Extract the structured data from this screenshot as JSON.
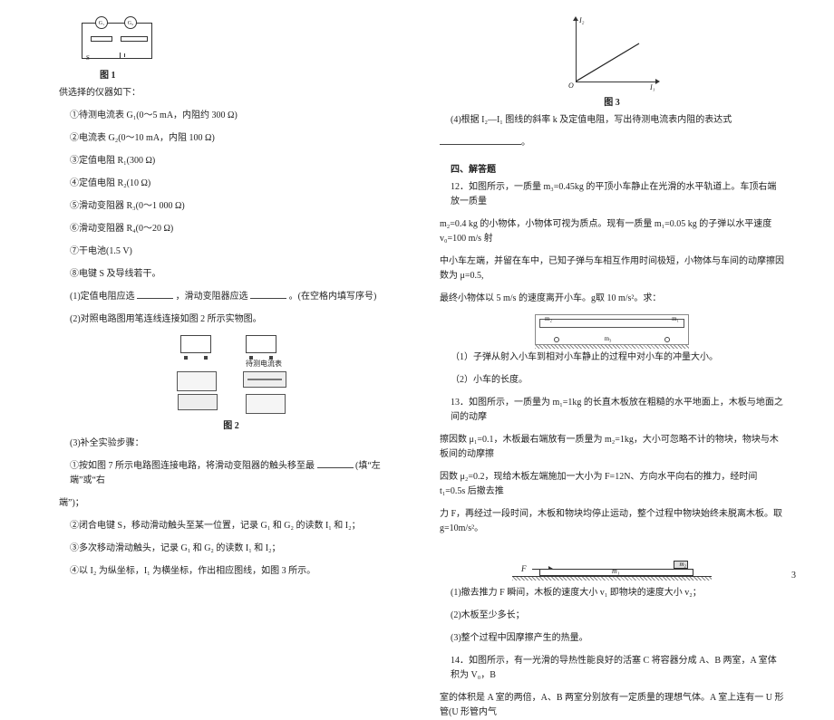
{
  "left": {
    "fig1_caption": "图 1",
    "instruments_intro": "供选择的仪器如下：",
    "items": [
      "①待测电流表 G₁(0～5 mA，内阻约 300 Ω)",
      "②电流表 G₂(0～10 mA，内阻 100 Ω)",
      "③定值电阻 R₁(300 Ω)",
      "④定值电阻 R₂(10 Ω)",
      "⑤滑动变阻器 R₃(0～1 000 Ω)",
      "⑥滑动变阻器 R₄(0～20 Ω)",
      "⑦干电池(1.5 V)",
      "⑧电键 S 及导线若干。"
    ],
    "q1_pre": "(1)定值电阻应选",
    "q1_mid": "，滑动变阻器应选",
    "q1_post": "。(在空格内填写序号)",
    "q2": "(2)对照电路图用笔连线连接如图 2 所示实物图。",
    "fig2_label_meter": "待测电流表",
    "fig2_caption": "图 2",
    "q3_head": "(3)补全实验步骤：",
    "q3_step1_pre": "①按如图 7 所示电路图连接电路，将滑动变阻器的触头移至最",
    "q3_step1_hint": "(填“左端”或“右",
    "q3_step1_post": "端”)；",
    "q3_step2": "②闭合电键 S，移动滑动触头至某一位置，记录 G₁ 和 G₂ 的读数 I₁ 和 I₂；",
    "q3_step3": "③多次移动滑动触头，记录 G₁ 和 G₂ 的读数 I₁ 和 I₂；",
    "q3_step4": "④以 I₂ 为纵坐标，I₁ 为横坐标，作出相应图线，如图 3 所示。"
  },
  "right": {
    "fig3_caption": "图 3",
    "fig3_lblO": "O",
    "fig3_lblY": "I₂",
    "fig3_lblX": "I₁",
    "q4": "(4)根据 I₂—I₁ 图线的斜率 k 及定值电阻，写出待测电流表内阻的表达式",
    "sec4": "四、解答题",
    "p12a": "12．如图所示，一质量 m₃=0.45kg 的平顶小车静止在光滑的水平轨道上。车顶右端放一质量",
    "p12b": "m₂=0.4 kg 的小物体，小物体可视为质点。现有一质量 m₁=0.05 kg 的子弹以水平速度 v₀=100 m/s 射",
    "p12c": "中小车左端，并留在车中，已知子弹与车相互作用时间极短，小物体与车间的动摩擦因数为 μ=0.5,",
    "p12d": "最终小物体以 5 m/s 的速度离开小车。g取 10 m/s²。求：",
    "p12_cart_m1": "m₁",
    "p12_cart_m2": "m₂",
    "p12_cart_m3": "m₃",
    "p12q1": "（1）子弹从射入小车到相对小车静止的过程中对小车的冲量大小。",
    "p12q2": "（2）小车的长度。",
    "p13a": "13．如图所示，一质量为 m₁=1kg 的长直木板放在粗糙的水平地面上，木板与地面之间的动摩",
    "p13b": "擦因数 μ₁=0.1，木板最右端放有一质量为 m₂=1kg，大小可忽略不计的物块，物块与木板间的动摩擦",
    "p13c": "因数 μ₂=0.2，现给木板左端施加一大小为 F=12N、方向水平向右的推力，经时间 t₁=0.5s 后撤去推",
    "p13d": "力 F，再经过一段时间，木板和物块均停止运动，整个过程中物块始终未脱离木板。取 g=10m/s²。",
    "p13_F": "F",
    "p13_m1": "m₁",
    "p13_m2": "m₂",
    "p13q1": "(1)撤去推力 F 瞬间，木板的速度大小 v₁ 即物块的速度大小 v₂；",
    "p13q2": "(2)木板至少多长；",
    "p13q3": "(3)整个过程中因摩擦产生的热量。",
    "p14a": "14．如图所示，有一光滑的导热性能良好的活塞 C 将容器分成 A、B 两室，A 室体积为 V₀，B",
    "p14b": "室的体积是 A 室的两倍，A、B 两室分别放有一定质量的理想气体。A 室上连有一 U 形管(U 形管内气"
  },
  "page_num": "3",
  "chart_data": {
    "type": "line",
    "x": [
      0,
      1
    ],
    "series": [
      {
        "name": "I₂ vs I₁",
        "values": [
          0,
          0.65
        ]
      }
    ],
    "xlabel": "I₁",
    "ylabel": "I₂",
    "title": "",
    "xlim": [
      0,
      1
    ],
    "ylim": [
      0,
      1
    ],
    "note": "Straight line through origin; slope k represents ratio used to determine ammeter internal resistance."
  }
}
